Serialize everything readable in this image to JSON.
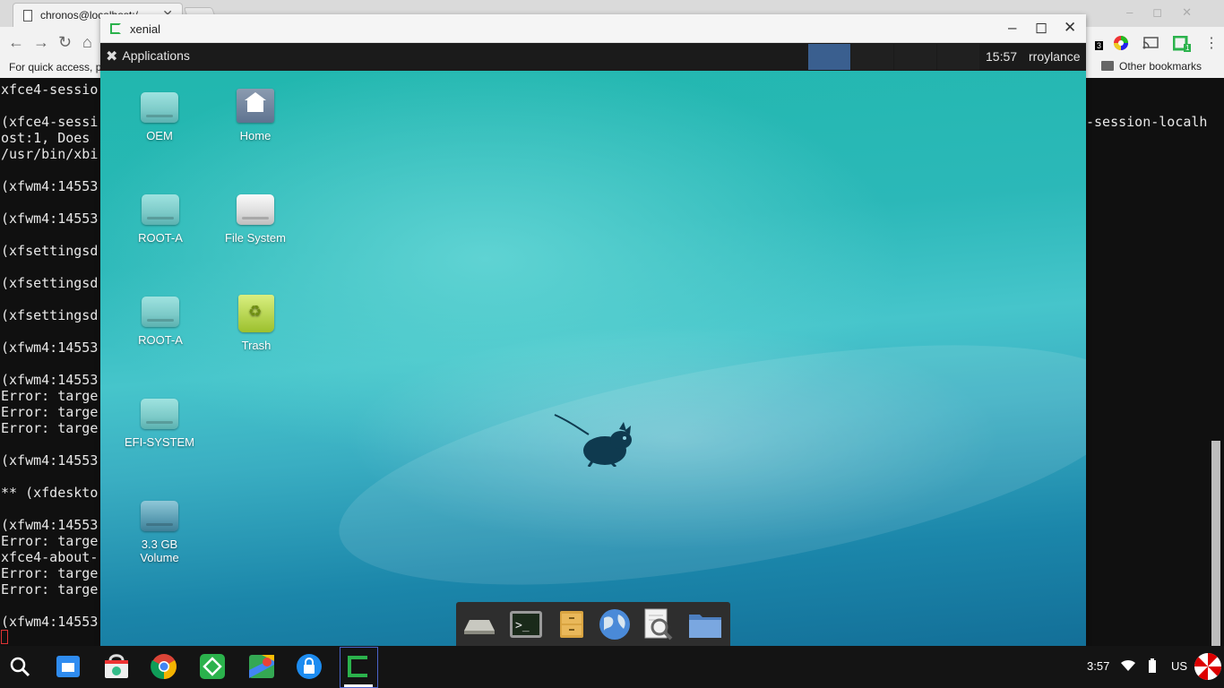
{
  "chrome": {
    "tab_title": "chronos@localhost:/",
    "tab_close": "✕",
    "window_controls": "–◻✕",
    "nav": {
      "back": "←",
      "forward": "→",
      "reload": "↻",
      "home": "⌂"
    },
    "bookmarks_prompt": "For quick access, p",
    "other_bookmarks": "Other bookmarks",
    "ext_badges": [
      "3",
      "1"
    ]
  },
  "terminal": {
    "lines": [
      "xfce4-sessio",
      "",
      "(xfce4-sessi",
      "ost:1, Does ",
      "/usr/bin/xbi",
      "",
      "(xfwm4:14553",
      "",
      "(xfwm4:14553",
      "",
      "(xfsettingsd",
      "",
      "(xfsettingsd",
      "",
      "(xfsettingsd",
      "",
      "(xfwm4:14553",
      "",
      "(xfwm4:14553",
      "Error: targe",
      "Error: targe",
      "Error: targe",
      "",
      "(xfwm4:14553",
      "",
      "** (xfdeskto",
      "",
      "(xfwm4:14553",
      "Error: targe",
      "xfce4-about-",
      "Error: targe",
      "Error: targe",
      "",
      "(xfwm4:14553"
    ],
    "right_text": "-session-localh"
  },
  "xenial": {
    "title": "xenial",
    "controls": {
      "minimize": "–",
      "maximize": "◻",
      "close": "✕"
    },
    "panel": {
      "applications_label": "Applications",
      "clock": "15:57",
      "user": "rroylance",
      "workspace_colors": [
        "#3a5f8f",
        "#202020",
        "#202020",
        "#202020"
      ]
    },
    "desktop_icons": [
      {
        "label": "OEM",
        "type": "drive"
      },
      {
        "label": "Home",
        "type": "home"
      },
      {
        "label": "ROOT-A",
        "type": "drive"
      },
      {
        "label": "File System",
        "type": "drive-grey"
      },
      {
        "label": "ROOT-A",
        "type": "drive"
      },
      {
        "label": "Trash",
        "type": "trash"
      },
      {
        "label": "EFI-SYSTEM",
        "type": "drive"
      },
      {
        "label": "3.3 GB Volume",
        "type": "drive-dark"
      }
    ],
    "dock_items": [
      "show-desktop",
      "terminal",
      "file-manager",
      "web-browser",
      "app-finder",
      "home-folder"
    ]
  },
  "shelf": {
    "apps": [
      "launcher",
      "files",
      "store",
      "chrome",
      "feedly",
      "maps",
      "secure-shell",
      "crouton"
    ],
    "status_time": "3:57",
    "input_lang": "US"
  },
  "colors": {
    "panel": "#1b1b1b",
    "desktop_top": "#21b7ae",
    "desktop_bottom": "#136f98",
    "shelf": "#141414",
    "terminal_bg": "#101010"
  }
}
